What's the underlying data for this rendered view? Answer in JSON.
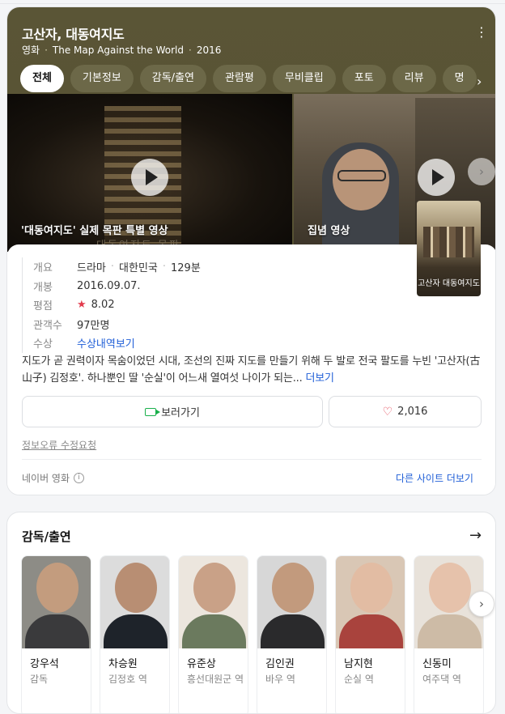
{
  "header": {
    "title": "고산자, 대동여지도",
    "more_icon": "⋮",
    "subtitle": {
      "type": "영화",
      "english_title": "The Map Against the World",
      "year": "2016"
    }
  },
  "tabs": [
    {
      "label": "전체",
      "active": true
    },
    {
      "label": "기본정보"
    },
    {
      "label": "감독/출연"
    },
    {
      "label": "관람평"
    },
    {
      "label": "무비클립"
    },
    {
      "label": "포토"
    },
    {
      "label": "리뷰"
    },
    {
      "label": "명"
    }
  ],
  "tab_arrow": "›",
  "clips": [
    {
      "label": "'대동여지도' 실제 목판 특별 영상",
      "watermark": "대동여지도 목판"
    },
    {
      "label": "집념 영상"
    }
  ],
  "carousel_arrow": "›",
  "poster": {
    "title": "고산자 대동여지도"
  },
  "info": {
    "overview": {
      "label": "개요",
      "genre": "드라마",
      "country": "대한민국",
      "runtime": "129분"
    },
    "release": {
      "label": "개봉",
      "value": "2016.09.07."
    },
    "rating": {
      "label": "평점",
      "star": "★",
      "value": "8.02"
    },
    "audience": {
      "label": "관객수",
      "value": "97만명"
    },
    "awards": {
      "label": "수상",
      "value": "수상내역보기"
    }
  },
  "description": {
    "text": "지도가 곧 권력이자 목숨이었던 시대, 조선의 진짜 지도를 만들기 위해 두 발로 전국 팔도를 누빈 '고산자(古山子) 김정호'. 하나뿐인 딸 '순실'이 어느새 열여섯 나이가 되는...",
    "more": "더보기"
  },
  "buttons": {
    "watch": "보러가기",
    "like_icon": "♡",
    "like_count": "2,016"
  },
  "report_link": "정보오류 수정요청",
  "source": {
    "label": "네이버 영화",
    "info_icon": "i",
    "other_sites": "다른 사이트 더보기"
  },
  "cast_section": {
    "title": "감독/출연",
    "arrow": "→",
    "next": "›",
    "people": [
      {
        "name": "강우석",
        "role": "감독"
      },
      {
        "name": "차승원",
        "role": "김정호 역"
      },
      {
        "name": "유준상",
        "role": "흥선대원군 역"
      },
      {
        "name": "김인권",
        "role": "바우 역"
      },
      {
        "name": "남지현",
        "role": "순실 역"
      },
      {
        "name": "신동미",
        "role": "여주댁 역"
      }
    ]
  },
  "colors": {
    "hero_bg": "#575233",
    "tab_bg": "#6c6848",
    "link": "#1f5ed7",
    "accent_red": "#e23b4c",
    "watch_green": "#19b04b"
  }
}
